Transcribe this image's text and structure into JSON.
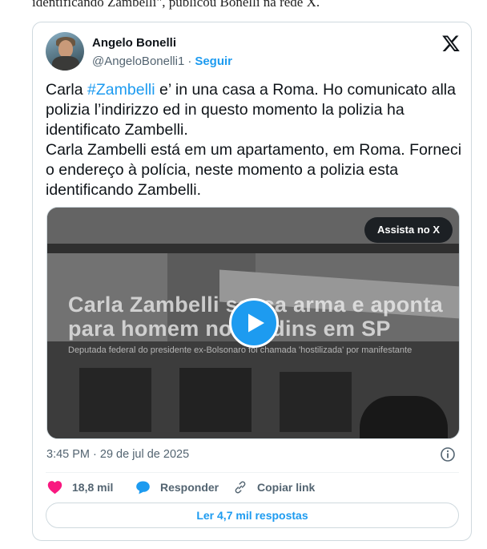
{
  "article": {
    "top_text": "identificando Zambelli\", publicou Bonelli na rede X."
  },
  "author": {
    "name": "Angelo Bonelli",
    "handle": "@AngeloBonelli1",
    "separator": "·",
    "follow_label": "Seguir"
  },
  "tweet": {
    "text_before_hashtag": "Carla ",
    "hashtag": "#Zambelli",
    "text_after_hashtag": " e’ in una casa a Roma.  Ho comunicato alla polizia l’indirizzo ed  in questo momento la polizia ha identificato Zambelli.\nCarla Zambelli está em um apartamento, em Roma. Forneci o endereço à polícia, neste momento a polizia esta identificando Zambelli.",
    "timestamp": "3:45 PM · 29 de jul de 2025"
  },
  "media": {
    "watch_label": "Assista no X",
    "headline": "Carla Zambelli sacca arma e aponta\npara homem no Jardins em SP",
    "subline": "Deputada federal do presidente ex-Bolsonaro foi chamada 'hostilizada' por manifestante",
    "play_icon": "play-icon"
  },
  "actions": {
    "likes_count": "18,8 mil",
    "reply_label": "Responder",
    "copy_link_label": "Copiar link",
    "read_replies_label": "Ler 4,7 mil respostas"
  },
  "colors": {
    "accent": "#1d9bf0",
    "like": "#f91880",
    "muted": "#536471",
    "border": "#cfd9de"
  }
}
